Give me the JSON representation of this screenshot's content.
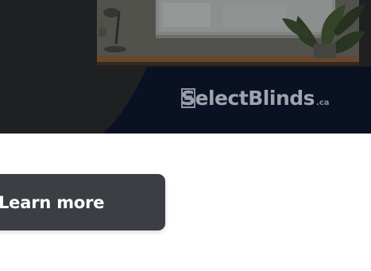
{
  "banner": {
    "brand_name": "SelectBlinds",
    "brand_tld": ".ca",
    "logo_icon": "blind-slats-icon"
  },
  "cta": {
    "label": "Learn more"
  },
  "colors": {
    "banner_dark": "#1f2023",
    "navy_panel": "#0b1326",
    "button_bg": "#3b3f44",
    "button_text": "#ffffff",
    "logo_text": "#9ea3ae"
  }
}
